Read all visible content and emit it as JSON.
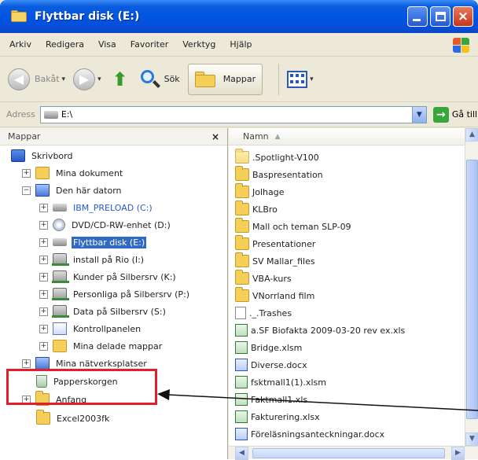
{
  "window": {
    "title": "Flyttbar disk (E:)",
    "controls": {
      "minimize": "",
      "maximize": "",
      "close": "×"
    }
  },
  "menubar": {
    "items": [
      "Arkiv",
      "Redigera",
      "Visa",
      "Favoriter",
      "Verktyg",
      "Hjälp"
    ]
  },
  "toolbar": {
    "back_label": "Bakåt",
    "search_label": "Sök",
    "folders_label": "Mappar"
  },
  "address": {
    "label": "Adress",
    "value": "E:\\",
    "go_label": "Gå till"
  },
  "folders_pane": {
    "title": "Mappar",
    "close": "×",
    "tree": [
      {
        "label": "Skrivbord",
        "icon": "desktop-icon",
        "expander": ""
      },
      {
        "label": "Mina dokument",
        "icon": "folder-icon",
        "expander": "+"
      },
      {
        "label": "Den här datorn",
        "icon": "computer-icon",
        "expander": "−"
      },
      {
        "label": "IBM_PRELOAD (C:)",
        "icon": "drive-icon",
        "expander": "+"
      },
      {
        "label": "DVD/CD-RW-enhet (D:)",
        "icon": "cd-drive-icon",
        "expander": "+"
      },
      {
        "label": "Flyttbar disk (E:)",
        "icon": "drive-icon",
        "expander": "+",
        "selected": true
      },
      {
        "label": "install på Rio (I:)",
        "icon": "network-drive-icon",
        "expander": "+"
      },
      {
        "label": "Kunder på Silbersrv (K:)",
        "icon": "network-drive-icon",
        "expander": "+"
      },
      {
        "label": "Personliga på Silbersrv (P:)",
        "icon": "network-drive-icon",
        "expander": "+"
      },
      {
        "label": "Data på Silbersrv (S:)",
        "icon": "network-drive-icon",
        "expander": "+"
      },
      {
        "label": "Kontrollpanelen",
        "icon": "control-panel-icon",
        "expander": "+"
      },
      {
        "label": "Mina delade mappar",
        "icon": "shared-folder-icon",
        "expander": "+"
      },
      {
        "label": "Mina nätverksplatser",
        "icon": "network-places-icon",
        "expander": "+"
      },
      {
        "label": "Papperskorgen",
        "icon": "recycle-bin-icon",
        "expander": ""
      },
      {
        "label": "Anfang",
        "icon": "folder-icon",
        "expander": "+"
      },
      {
        "label": "Excel2003fk",
        "icon": "folder-icon",
        "expander": ""
      }
    ]
  },
  "file_list": {
    "column_name": "Namn",
    "sort_indicator": "▲",
    "items": [
      {
        "name": ".Spotlight-V100",
        "icon": "faded-folder-icon"
      },
      {
        "name": "Baspresentation",
        "icon": "folder-icon"
      },
      {
        "name": "Jolhage",
        "icon": "folder-icon"
      },
      {
        "name": "KLBro",
        "icon": "folder-icon"
      },
      {
        "name": "Mall och teman SLP-09",
        "icon": "folder-icon"
      },
      {
        "name": "Presentationer",
        "icon": "folder-icon"
      },
      {
        "name": "SV Mallar_files",
        "icon": "folder-icon"
      },
      {
        "name": "VBA-kurs",
        "icon": "folder-icon"
      },
      {
        "name": "VNorrland film",
        "icon": "folder-icon"
      },
      {
        "name": "._.Trashes",
        "icon": "file-icon"
      },
      {
        "name": "a.SF Biofakta 2009-03-20 rev ex.xls",
        "icon": "excel-icon"
      },
      {
        "name": "Bridge.xlsm",
        "icon": "excel-icon"
      },
      {
        "name": "Diverse.docx",
        "icon": "word-icon"
      },
      {
        "name": "fsktmall1(1).xlsm",
        "icon": "excel-icon"
      },
      {
        "name": "Faktmall1.xls",
        "icon": "excel-icon"
      },
      {
        "name": "Fakturering.xlsx",
        "icon": "excel-icon"
      },
      {
        "name": "Föreläsningsanteckningar.docx",
        "icon": "word-icon"
      }
    ]
  },
  "scrollbars": {
    "up": "▲",
    "down": "▼",
    "left": "◀",
    "right": "▶"
  },
  "annotation": {
    "color": "#e0202a",
    "arrow_color": "#111111"
  },
  "colors": {
    "selection": "#316ac5",
    "titlebar": "#0054e3"
  }
}
